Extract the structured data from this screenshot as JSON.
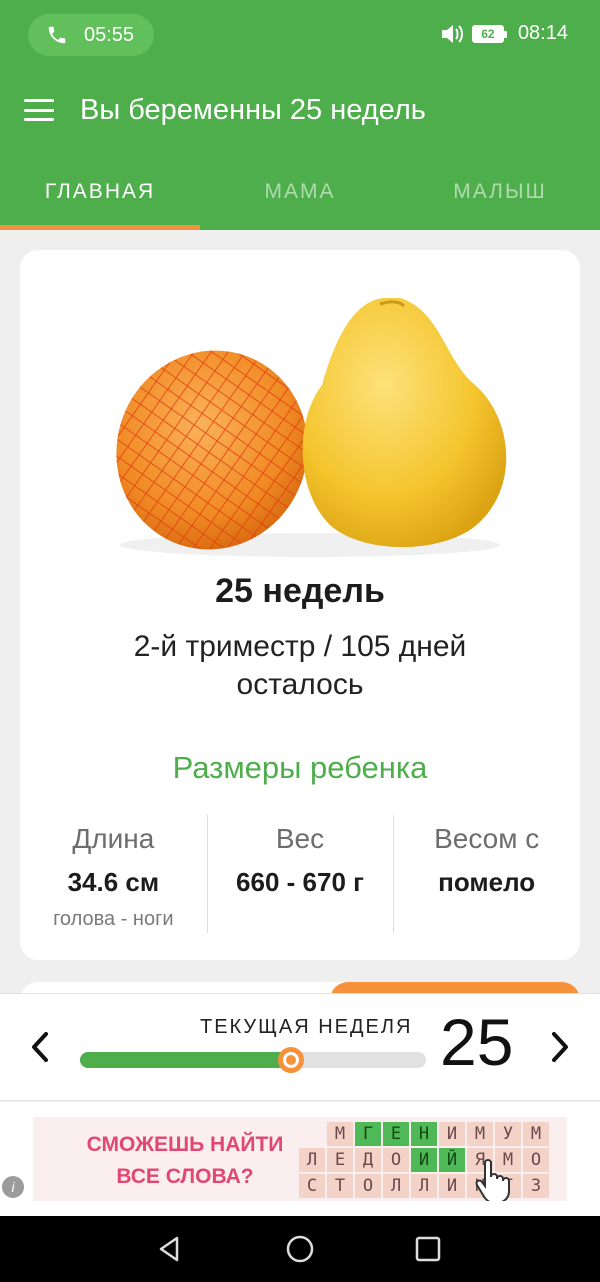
{
  "status_bar": {
    "call_time": "05:55",
    "battery": "62",
    "clock": "08:14"
  },
  "header": {
    "title": "Вы беременны 25 недель"
  },
  "tabs": [
    {
      "label": "ГЛАВНАЯ",
      "active": true
    },
    {
      "label": "МАМА",
      "active": false
    },
    {
      "label": "МАЛЫШ",
      "active": false
    }
  ],
  "card": {
    "week_title": "25 недель",
    "trimester": "2-й триместр / 105 дней осталось",
    "sizes_title": "Размеры ребенка",
    "stats": [
      {
        "label": "Длина",
        "value": "34.6 см",
        "sub": "голова - ноги"
      },
      {
        "label": "Вес",
        "value": "660 - 670 г",
        "sub": ""
      },
      {
        "label": "Весом с",
        "value": "помело",
        "sub": ""
      }
    ]
  },
  "week_selector": {
    "label": "ТЕКУЩАЯ НЕДЕЛЯ",
    "number": "25",
    "progress_percent": 61
  },
  "ad": {
    "line1": "СМОЖЕШЬ НАЙТИ",
    "line2": "ВСЕ СЛОВА?",
    "grid": [
      [
        "М",
        "Г",
        "Е",
        "Н",
        "И",
        "М",
        "У",
        "М"
      ],
      [
        "Л",
        "Е",
        "Д",
        "О",
        "И",
        "Й",
        "Я",
        "М",
        "О"
      ],
      [
        "С",
        "Т",
        "О",
        "Л",
        "Л",
        "И",
        "Н",
        "Г",
        "З"
      ]
    ]
  },
  "colors": {
    "brand_green": "#4eae4c",
    "accent_orange": "#f6923b"
  }
}
